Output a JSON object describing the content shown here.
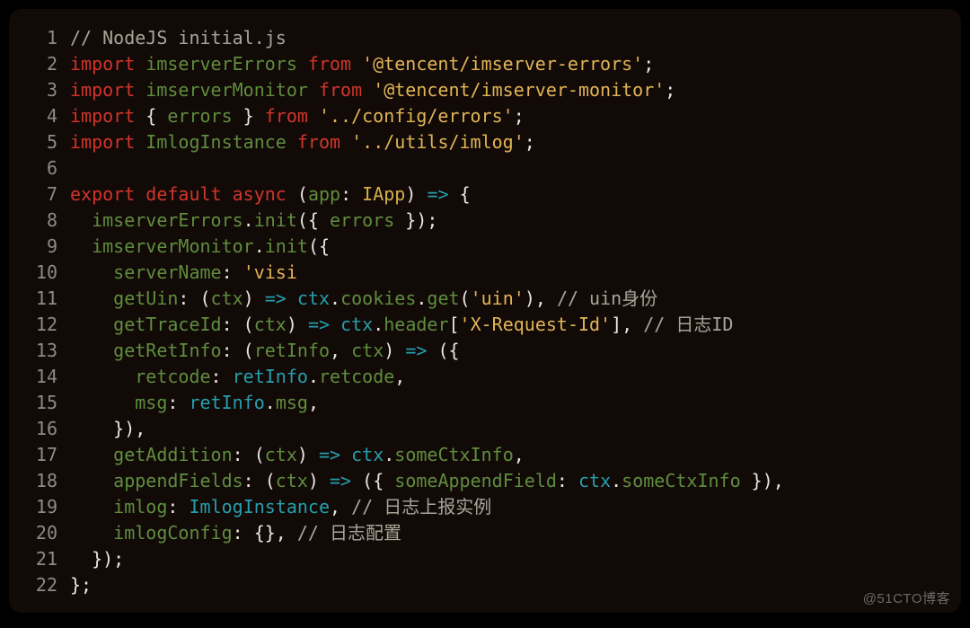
{
  "watermark": "@51CTO博客",
  "code": {
    "lines": [
      {
        "n": "1",
        "tokens": [
          {
            "t": "// NodeJS initial.js",
            "c": "cm"
          }
        ]
      },
      {
        "n": "2",
        "tokens": [
          {
            "t": "import",
            "c": "kw"
          },
          {
            "t": " ",
            "c": "pl"
          },
          {
            "t": "imserverErrors",
            "c": "fn"
          },
          {
            "t": " ",
            "c": "pl"
          },
          {
            "t": "from",
            "c": "kw"
          },
          {
            "t": " ",
            "c": "pl"
          },
          {
            "t": "'@tencent/imserver-errors'",
            "c": "str"
          },
          {
            "t": ";",
            "c": "pl"
          }
        ]
      },
      {
        "n": "3",
        "tokens": [
          {
            "t": "import",
            "c": "kw"
          },
          {
            "t": " ",
            "c": "pl"
          },
          {
            "t": "imserverMonitor",
            "c": "fn"
          },
          {
            "t": " ",
            "c": "pl"
          },
          {
            "t": "from",
            "c": "kw"
          },
          {
            "t": " ",
            "c": "pl"
          },
          {
            "t": "'@tencent/imserver-monitor'",
            "c": "str"
          },
          {
            "t": ";",
            "c": "pl"
          }
        ]
      },
      {
        "n": "4",
        "tokens": [
          {
            "t": "import",
            "c": "kw"
          },
          {
            "t": " { ",
            "c": "pl"
          },
          {
            "t": "errors",
            "c": "fn"
          },
          {
            "t": " } ",
            "c": "pl"
          },
          {
            "t": "from",
            "c": "kw"
          },
          {
            "t": " ",
            "c": "pl"
          },
          {
            "t": "'../config/errors'",
            "c": "str"
          },
          {
            "t": ";",
            "c": "pl"
          }
        ]
      },
      {
        "n": "5",
        "tokens": [
          {
            "t": "import",
            "c": "kw"
          },
          {
            "t": " ",
            "c": "pl"
          },
          {
            "t": "ImlogInstance",
            "c": "fn"
          },
          {
            "t": " ",
            "c": "pl"
          },
          {
            "t": "from",
            "c": "kw"
          },
          {
            "t": " ",
            "c": "pl"
          },
          {
            "t": "'../utils/imlog'",
            "c": "str"
          },
          {
            "t": ";",
            "c": "pl"
          }
        ]
      },
      {
        "n": "6",
        "tokens": [
          {
            "t": "",
            "c": "pl"
          }
        ]
      },
      {
        "n": "7",
        "tokens": [
          {
            "t": "export",
            "c": "kw"
          },
          {
            "t": " ",
            "c": "pl"
          },
          {
            "t": "default",
            "c": "kw"
          },
          {
            "t": " ",
            "c": "pl"
          },
          {
            "t": "async",
            "c": "kw"
          },
          {
            "t": " (",
            "c": "pl"
          },
          {
            "t": "app",
            "c": "fn"
          },
          {
            "t": ": ",
            "c": "pl"
          },
          {
            "t": "IApp",
            "c": "typ"
          },
          {
            "t": ") ",
            "c": "pl"
          },
          {
            "t": "=>",
            "c": "id"
          },
          {
            "t": " {",
            "c": "pl"
          }
        ]
      },
      {
        "n": "8",
        "tokens": [
          {
            "t": "  ",
            "c": "pl"
          },
          {
            "t": "imserverErrors",
            "c": "fn"
          },
          {
            "t": ".",
            "c": "pl"
          },
          {
            "t": "init",
            "c": "fn"
          },
          {
            "t": "({ ",
            "c": "pl"
          },
          {
            "t": "errors",
            "c": "fn"
          },
          {
            "t": " });",
            "c": "pl"
          }
        ]
      },
      {
        "n": "9",
        "tokens": [
          {
            "t": "  ",
            "c": "pl"
          },
          {
            "t": "imserverMonitor",
            "c": "fn"
          },
          {
            "t": ".",
            "c": "pl"
          },
          {
            "t": "init",
            "c": "fn"
          },
          {
            "t": "({",
            "c": "pl"
          }
        ]
      },
      {
        "n": "10",
        "tokens": [
          {
            "t": "    ",
            "c": "pl"
          },
          {
            "t": "serverName",
            "c": "fn"
          },
          {
            "t": ": ",
            "c": "pl"
          },
          {
            "t": "'visi",
            "c": "str"
          }
        ]
      },
      {
        "n": "11",
        "tokens": [
          {
            "t": "    ",
            "c": "pl"
          },
          {
            "t": "getUin",
            "c": "fn"
          },
          {
            "t": ": (",
            "c": "pl"
          },
          {
            "t": "ctx",
            "c": "fn"
          },
          {
            "t": ") ",
            "c": "pl"
          },
          {
            "t": "=>",
            "c": "id"
          },
          {
            "t": " ",
            "c": "pl"
          },
          {
            "t": "ctx",
            "c": "id"
          },
          {
            "t": ".",
            "c": "pl"
          },
          {
            "t": "cookies",
            "c": "fn"
          },
          {
            "t": ".",
            "c": "pl"
          },
          {
            "t": "get",
            "c": "fn"
          },
          {
            "t": "(",
            "c": "pl"
          },
          {
            "t": "'uin'",
            "c": "str"
          },
          {
            "t": "), ",
            "c": "pl"
          },
          {
            "t": "// uin身份",
            "c": "cm"
          }
        ]
      },
      {
        "n": "12",
        "tokens": [
          {
            "t": "    ",
            "c": "pl"
          },
          {
            "t": "getTraceId",
            "c": "fn"
          },
          {
            "t": ": (",
            "c": "pl"
          },
          {
            "t": "ctx",
            "c": "fn"
          },
          {
            "t": ") ",
            "c": "pl"
          },
          {
            "t": "=>",
            "c": "id"
          },
          {
            "t": " ",
            "c": "pl"
          },
          {
            "t": "ctx",
            "c": "id"
          },
          {
            "t": ".",
            "c": "pl"
          },
          {
            "t": "header",
            "c": "fn"
          },
          {
            "t": "[",
            "c": "pl"
          },
          {
            "t": "'X-Request-Id'",
            "c": "str"
          },
          {
            "t": "], ",
            "c": "pl"
          },
          {
            "t": "// 日志ID",
            "c": "cm"
          }
        ]
      },
      {
        "n": "13",
        "tokens": [
          {
            "t": "    ",
            "c": "pl"
          },
          {
            "t": "getRetInfo",
            "c": "fn"
          },
          {
            "t": ": (",
            "c": "pl"
          },
          {
            "t": "retInfo",
            "c": "fn"
          },
          {
            "t": ", ",
            "c": "pl"
          },
          {
            "t": "ctx",
            "c": "fn"
          },
          {
            "t": ") ",
            "c": "pl"
          },
          {
            "t": "=>",
            "c": "id"
          },
          {
            "t": " ({",
            "c": "pl"
          }
        ]
      },
      {
        "n": "14",
        "tokens": [
          {
            "t": "      ",
            "c": "pl"
          },
          {
            "t": "retcode",
            "c": "fn"
          },
          {
            "t": ": ",
            "c": "pl"
          },
          {
            "t": "retInfo",
            "c": "id"
          },
          {
            "t": ".",
            "c": "pl"
          },
          {
            "t": "retcode",
            "c": "fn"
          },
          {
            "t": ",",
            "c": "pl"
          }
        ]
      },
      {
        "n": "15",
        "tokens": [
          {
            "t": "      ",
            "c": "pl"
          },
          {
            "t": "msg",
            "c": "fn"
          },
          {
            "t": ": ",
            "c": "pl"
          },
          {
            "t": "retInfo",
            "c": "id"
          },
          {
            "t": ".",
            "c": "pl"
          },
          {
            "t": "msg",
            "c": "fn"
          },
          {
            "t": ",",
            "c": "pl"
          }
        ]
      },
      {
        "n": "16",
        "tokens": [
          {
            "t": "    }),",
            "c": "pl"
          }
        ]
      },
      {
        "n": "17",
        "tokens": [
          {
            "t": "    ",
            "c": "pl"
          },
          {
            "t": "getAddition",
            "c": "fn"
          },
          {
            "t": ": (",
            "c": "pl"
          },
          {
            "t": "ctx",
            "c": "fn"
          },
          {
            "t": ") ",
            "c": "pl"
          },
          {
            "t": "=>",
            "c": "id"
          },
          {
            "t": " ",
            "c": "pl"
          },
          {
            "t": "ctx",
            "c": "id"
          },
          {
            "t": ".",
            "c": "pl"
          },
          {
            "t": "someCtxInfo",
            "c": "fn"
          },
          {
            "t": ",",
            "c": "pl"
          }
        ]
      },
      {
        "n": "18",
        "tokens": [
          {
            "t": "    ",
            "c": "pl"
          },
          {
            "t": "appendFields",
            "c": "fn"
          },
          {
            "t": ": (",
            "c": "pl"
          },
          {
            "t": "ctx",
            "c": "fn"
          },
          {
            "t": ") ",
            "c": "pl"
          },
          {
            "t": "=>",
            "c": "id"
          },
          {
            "t": " ({ ",
            "c": "pl"
          },
          {
            "t": "someAppendField",
            "c": "fn"
          },
          {
            "t": ": ",
            "c": "pl"
          },
          {
            "t": "ctx",
            "c": "id"
          },
          {
            "t": ".",
            "c": "pl"
          },
          {
            "t": "someCtxInfo",
            "c": "fn"
          },
          {
            "t": " }),",
            "c": "pl"
          }
        ]
      },
      {
        "n": "19",
        "tokens": [
          {
            "t": "    ",
            "c": "pl"
          },
          {
            "t": "imlog",
            "c": "fn"
          },
          {
            "t": ": ",
            "c": "pl"
          },
          {
            "t": "ImlogInstance",
            "c": "id"
          },
          {
            "t": ", ",
            "c": "pl"
          },
          {
            "t": "// 日志上报实例",
            "c": "cm"
          }
        ]
      },
      {
        "n": "20",
        "tokens": [
          {
            "t": "    ",
            "c": "pl"
          },
          {
            "t": "imlogConfig",
            "c": "fn"
          },
          {
            "t": ": {}, ",
            "c": "pl"
          },
          {
            "t": "// 日志配置",
            "c": "cm"
          }
        ]
      },
      {
        "n": "21",
        "tokens": [
          {
            "t": "  });",
            "c": "pl"
          }
        ]
      },
      {
        "n": "22",
        "tokens": [
          {
            "t": "};",
            "c": "pl"
          }
        ]
      }
    ]
  }
}
